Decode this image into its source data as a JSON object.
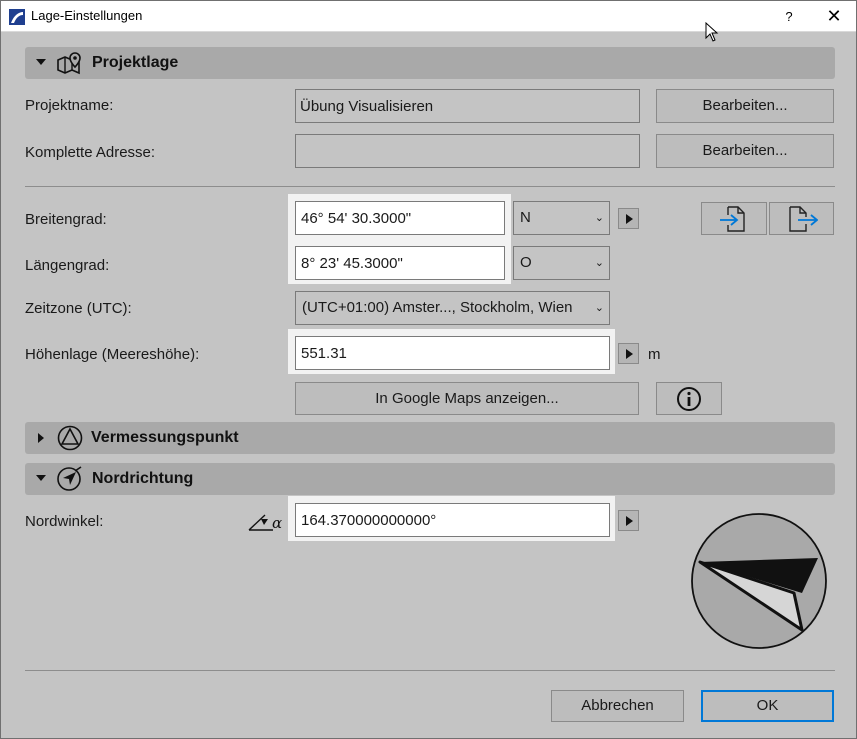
{
  "window": {
    "title": "Lage-Einstellungen",
    "help_label": "?",
    "close_label": "✕"
  },
  "projektlage": {
    "title": "Projektlage",
    "projektname_label": "Projektname:",
    "projektname_value": "Übung Visualisieren",
    "adresse_label": "Komplette Adresse:",
    "adresse_value": "",
    "bearbeiten_label": "Bearbeiten...",
    "breitengrad_label": "Breitengrad:",
    "breitengrad_value": "46° 54' 30.3000\"",
    "breitengrad_dir": "N",
    "laengengrad_label": "Längengrad:",
    "laengengrad_value": "8° 23' 45.3000\"",
    "laengengrad_dir": "O",
    "zeitzone_label": "Zeitzone (UTC):",
    "zeitzone_value": "(UTC+01:00) Amster..., Stockholm, Wien",
    "hoehe_label": "Höhenlage (Meereshöhe):",
    "hoehe_value": "551.31",
    "hoehe_unit": "m",
    "google_maps_label": "In Google Maps anzeigen...",
    "info_icon": "info-icon",
    "import_icon": "import-file-icon",
    "export_icon": "export-file-icon"
  },
  "vermessungspunkt": {
    "title": "Vermessungspunkt"
  },
  "nordrichtung": {
    "title": "Nordrichtung",
    "nordwinkel_label": "Nordwinkel:",
    "nordwinkel_value": "164.370000000000°",
    "angle_icon": "angle-alpha-icon",
    "north_angle_deg": 164.37
  },
  "footer": {
    "cancel_label": "Abbrechen",
    "ok_label": "OK"
  },
  "colors": {
    "accent": "#0078d7",
    "section_bg": "#a9a9a9",
    "dialog_bg": "#c4c4c4"
  }
}
